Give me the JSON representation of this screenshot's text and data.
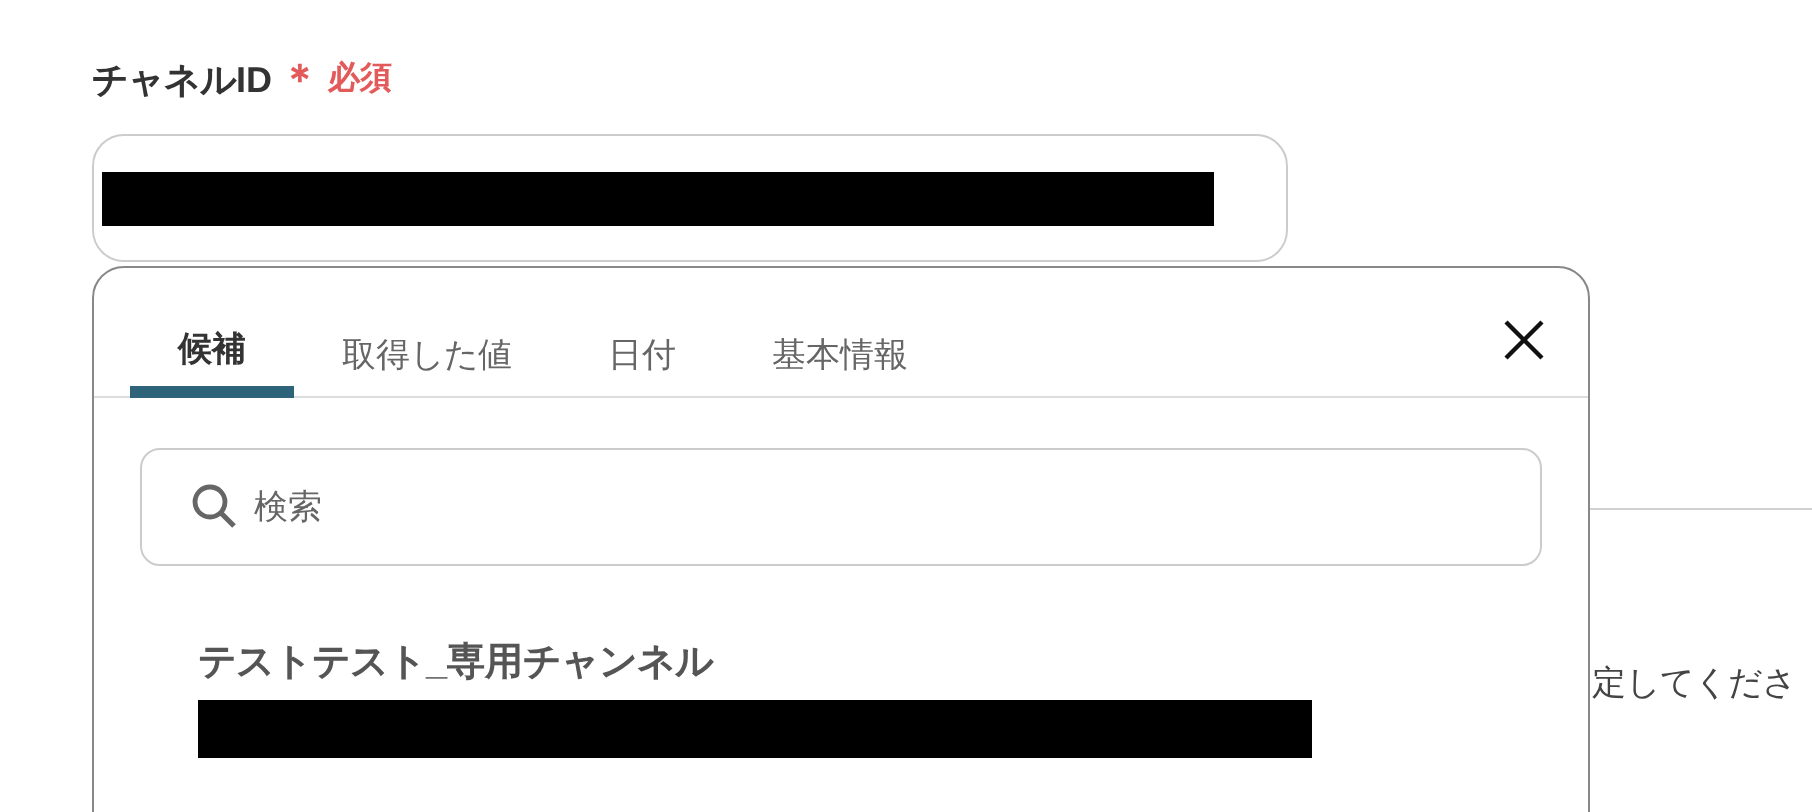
{
  "field": {
    "label": "チャネルID",
    "required_mark": "＊",
    "required_text": "必須"
  },
  "background_hint": "定してくださ",
  "popover": {
    "tabs": [
      {
        "label": "候補",
        "selected": true
      },
      {
        "label": "取得した値",
        "selected": false
      },
      {
        "label": "日付",
        "selected": false
      },
      {
        "label": "基本情報",
        "selected": false
      }
    ],
    "search": {
      "placeholder": "検索"
    },
    "options": [
      {
        "title": "テストテスト_専用チャンネル"
      }
    ]
  }
}
